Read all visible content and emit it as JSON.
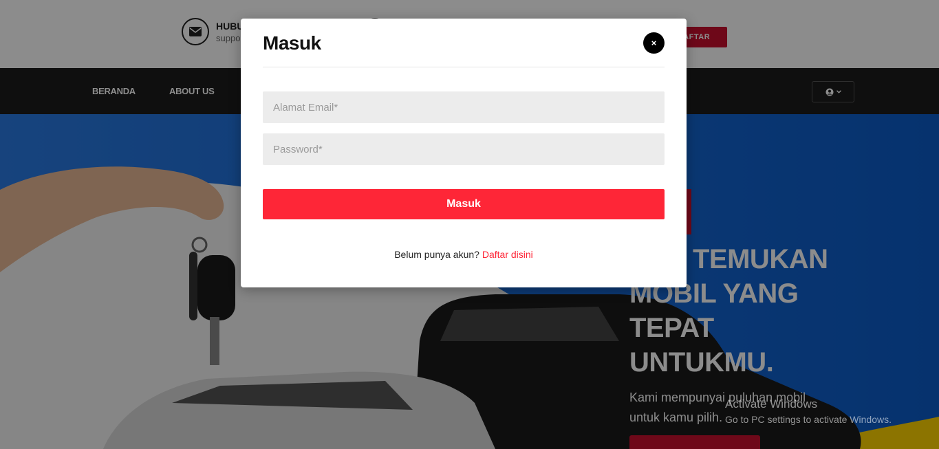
{
  "topbar": {
    "contact_title": "HUBUNGI KAMI",
    "contact_sub": "support@",
    "register_button": "DAFTAR"
  },
  "nav": {
    "items": [
      {
        "label": "BERANDA"
      },
      {
        "label": "ABOUT US"
      }
    ],
    "user_menu_icon": "user-circle-icon"
  },
  "hero": {
    "title_lines": [
      "TEMUKAN",
      "MOBIL YANG",
      "TEPAT",
      "UNTUKMU."
    ],
    "description": "Kami mempunyai puluhan mobil untuk kamu pilih."
  },
  "modal": {
    "title": "Masuk",
    "close_label": "×",
    "email_placeholder": "Alamat Email*",
    "password_placeholder": "Password*",
    "submit_label": "Masuk",
    "register_prompt": "Belum punya akun?",
    "register_link": "Daftar disini"
  },
  "watermark": {
    "title": "Activate Windows",
    "subtitle": "Go to PC settings to activate Windows."
  },
  "colors": {
    "accent_red": "#fe2637",
    "brand_red": "#c8102e",
    "nav_bg": "#1c1c1c",
    "hero_blue": "#1f6fe0"
  }
}
